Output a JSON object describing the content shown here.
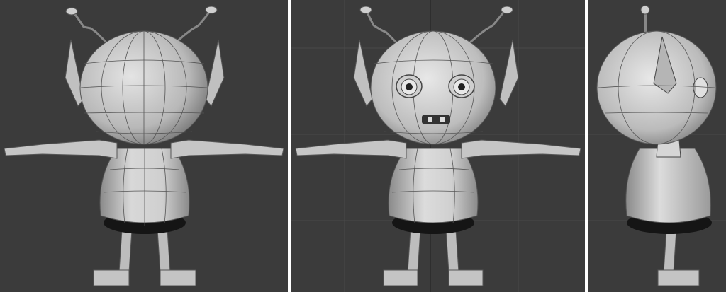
{
  "viewports": [
    {
      "id": "back",
      "view": "back-orthographic",
      "active": false
    },
    {
      "id": "front",
      "view": "front-orthographic",
      "active": true
    },
    {
      "id": "side",
      "view": "left-orthographic",
      "active": false
    }
  ],
  "colors": {
    "viewport_bg": "#3b3b3b",
    "grid_line": "#4a4a4a",
    "grid_axis": "#2a2a2a",
    "model_fill": "#c8c8c8",
    "model_shade": "#9a9a9a",
    "wire": "#4d4d4d",
    "separator": "#ffffff"
  },
  "icons": [
    "3d-model-character"
  ]
}
